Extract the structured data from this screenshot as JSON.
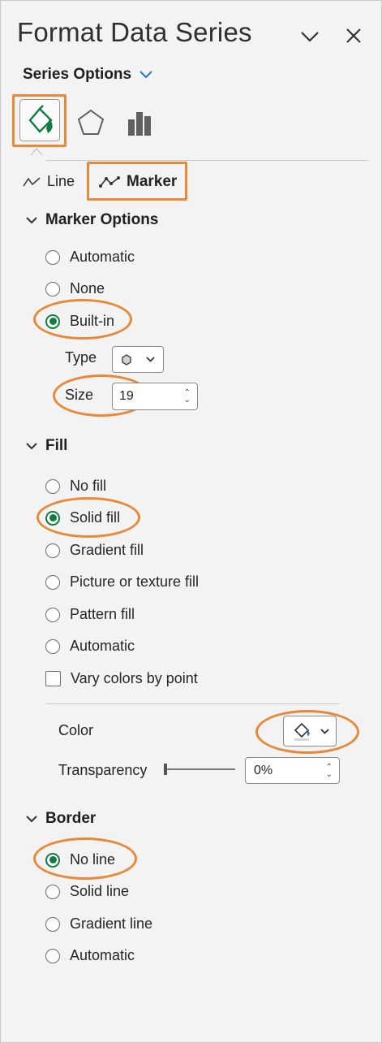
{
  "panel": {
    "title": "Format Data Series",
    "series_options_label": "Series Options",
    "tabs": [
      "fill-line",
      "effects",
      "series-options"
    ],
    "subtabs": {
      "line": "Line",
      "marker": "Marker"
    }
  },
  "marker_options": {
    "heading": "Marker Options",
    "options": [
      "Automatic",
      "None",
      "Built-in"
    ],
    "selected": "Built-in",
    "type_label": "Type",
    "size_label": "Size",
    "size_value": "19"
  },
  "fill": {
    "heading": "Fill",
    "options": [
      "No fill",
      "Solid fill",
      "Gradient fill",
      "Picture or texture fill",
      "Pattern fill",
      "Automatic"
    ],
    "selected": "Solid fill",
    "vary_colors_label": "Vary colors by point",
    "color_label": "Color",
    "transparency_label": "Transparency",
    "transparency_value": "0%"
  },
  "border": {
    "heading": "Border",
    "options": [
      "No line",
      "Solid line",
      "Gradient line",
      "Automatic"
    ],
    "selected": "No line"
  },
  "colors": {
    "accent_green": "#107c41",
    "highlight_orange": "#e8893a",
    "chevron_blue": "#2a6fcf"
  }
}
